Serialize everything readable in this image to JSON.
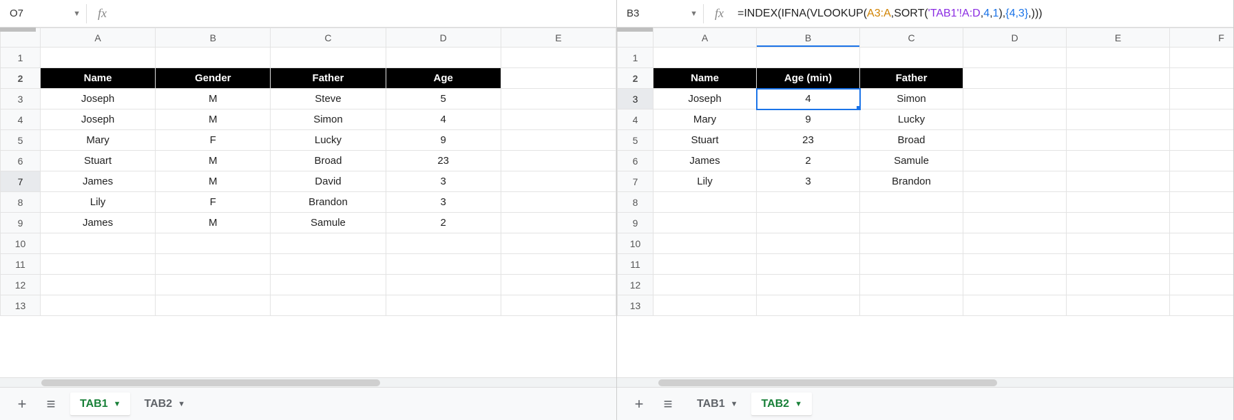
{
  "left": {
    "namebox": "O7",
    "formula": "",
    "columns": [
      "A",
      "B",
      "C",
      "D",
      "E"
    ],
    "rows": [
      "1",
      "2",
      "3",
      "4",
      "5",
      "6",
      "7",
      "8",
      "9",
      "10",
      "11",
      "12",
      "13"
    ],
    "header_row": 2,
    "headers": [
      "Name",
      "Gender",
      "Father",
      "Age"
    ],
    "data_start_row": 3,
    "data": [
      [
        "Joseph",
        "M",
        "Steve",
        "5"
      ],
      [
        "Joseph",
        "M",
        "Simon",
        "4"
      ],
      [
        "Mary",
        "F",
        "Lucky",
        "9"
      ],
      [
        "Stuart",
        "M",
        "Broad",
        "23"
      ],
      [
        "James",
        "M",
        "David",
        "3"
      ],
      [
        "Lily",
        "F",
        "Brandon",
        "3"
      ],
      [
        "James",
        "M",
        "Samule",
        "2"
      ]
    ],
    "selected_row": 7,
    "tabs": [
      {
        "label": "TAB1",
        "active": true
      },
      {
        "label": "TAB2",
        "active": false
      }
    ]
  },
  "right": {
    "namebox": "B3",
    "formula_tokens": [
      {
        "t": "=",
        "c": "plain"
      },
      {
        "t": "INDEX",
        "c": "fn"
      },
      {
        "t": "(",
        "c": "plain"
      },
      {
        "t": "IFNA",
        "c": "fn"
      },
      {
        "t": "(",
        "c": "plain"
      },
      {
        "t": "VLOOKUP",
        "c": "fn"
      },
      {
        "t": "(",
        "c": "plain"
      },
      {
        "t": "A3:A",
        "c": "range1"
      },
      {
        "t": ",",
        "c": "plain"
      },
      {
        "t": "SORT",
        "c": "fn"
      },
      {
        "t": "(",
        "c": "plain"
      },
      {
        "t": "'TAB1'!A:D",
        "c": "range2"
      },
      {
        "t": ",",
        "c": "plain"
      },
      {
        "t": "4",
        "c": "num"
      },
      {
        "t": ",",
        "c": "plain"
      },
      {
        "t": "1",
        "c": "num"
      },
      {
        "t": ")",
        "c": "plain"
      },
      {
        "t": ",",
        "c": "plain"
      },
      {
        "t": "{4,3}",
        "c": "arr"
      },
      {
        "t": ",",
        "c": "plain"
      },
      {
        "t": ")",
        "c": "plain"
      },
      {
        "t": ")",
        "c": "plain"
      },
      {
        "t": ")",
        "c": "plain"
      }
    ],
    "columns": [
      "A",
      "B",
      "C",
      "D",
      "E",
      "F"
    ],
    "rows": [
      "1",
      "2",
      "3",
      "4",
      "5",
      "6",
      "7",
      "8",
      "9",
      "10",
      "11",
      "12",
      "13"
    ],
    "header_row": 2,
    "headers": [
      "Name",
      "Age (min)",
      "Father"
    ],
    "data_start_row": 3,
    "data": [
      [
        "Joseph",
        "4",
        "Simon"
      ],
      [
        "Mary",
        "9",
        "Lucky"
      ],
      [
        "Stuart",
        "23",
        "Broad"
      ],
      [
        "James",
        "2",
        "Samule"
      ],
      [
        "Lily",
        "3",
        "Brandon"
      ]
    ],
    "selected_cell": {
      "row": 3,
      "col": "B"
    },
    "tabs": [
      {
        "label": "TAB1",
        "active": false
      },
      {
        "label": "TAB2",
        "active": true
      }
    ]
  },
  "chart_data": {
    "type": "table",
    "tables": [
      {
        "name": "TAB1",
        "columns": [
          "Name",
          "Gender",
          "Father",
          "Age"
        ],
        "rows": [
          [
            "Joseph",
            "M",
            "Steve",
            5
          ],
          [
            "Joseph",
            "M",
            "Simon",
            4
          ],
          [
            "Mary",
            "F",
            "Lucky",
            9
          ],
          [
            "Stuart",
            "M",
            "Broad",
            23
          ],
          [
            "James",
            "M",
            "David",
            3
          ],
          [
            "Lily",
            "F",
            "Brandon",
            3
          ],
          [
            "James",
            "M",
            "Samule",
            2
          ]
        ]
      },
      {
        "name": "TAB2",
        "columns": [
          "Name",
          "Age (min)",
          "Father"
        ],
        "rows": [
          [
            "Joseph",
            4,
            "Simon"
          ],
          [
            "Mary",
            9,
            "Lucky"
          ],
          [
            "Stuart",
            23,
            "Broad"
          ],
          [
            "James",
            2,
            "Samule"
          ],
          [
            "Lily",
            3,
            "Brandon"
          ]
        ]
      }
    ]
  }
}
